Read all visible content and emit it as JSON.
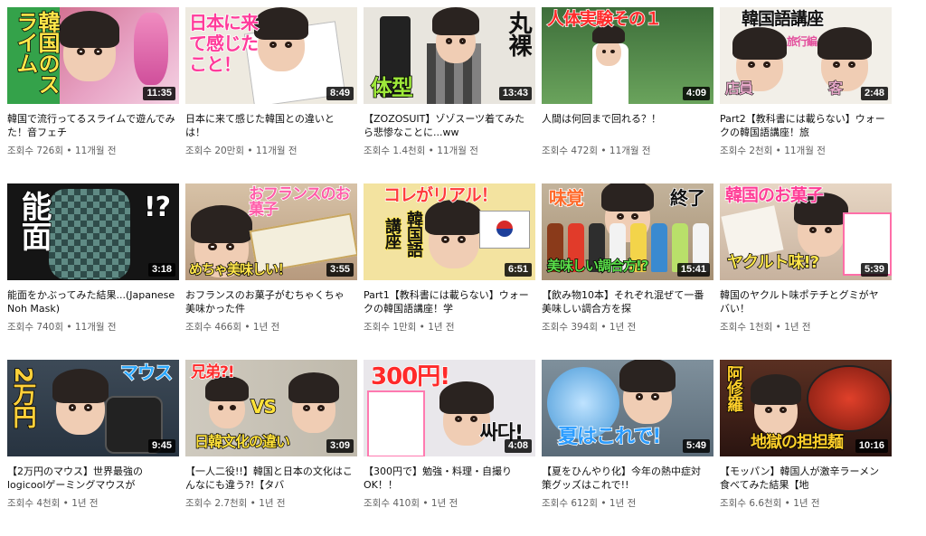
{
  "videos": [
    {
      "title": "韓国で流行ってるスライムで遊んでみた！音フェチ",
      "duration": "11:35",
      "views": "조회수 726회",
      "age": "11개월 전",
      "caption": "韓国のスライム",
      "bg": "#d46a8a",
      "accent": "#ffe74a"
    },
    {
      "title": "日本に来て感じた韓国との違いとは！",
      "duration": "8:49",
      "views": "조회수 20만회",
      "age": "11개월 전",
      "caption": "日本に来て感じたこと！",
      "bg": "#f4f0e6",
      "accent": "#ff4fa0"
    },
    {
      "title": "【ZOZOSUIT】ゾゾスーツ着てみたら悲惨なことに...ww",
      "duration": "13:43",
      "views": "조회수 1.4천회",
      "age": "11개월 전",
      "caption": "体型",
      "caption2": "丸裸",
      "bg": "#e9e6df",
      "accent": "#9ee83a"
    },
    {
      "title": "人間は何回まで回れる？！",
      "duration": "4:09",
      "views": "조회수 472회",
      "age": "11개월 전",
      "caption": "人体実験その１",
      "bg": "#3f7a3a",
      "accent": "#ff2a2a"
    },
    {
      "title": "Part2【教科書には載らない】ウォークの韓国語講座！旅",
      "duration": "2:48",
      "views": "조회수 2천회",
      "age": "11개월 전",
      "caption": "韓国語講座",
      "caption2": "旅行編",
      "caption3": "店員",
      "caption4": "客",
      "bg": "#f2f0ea",
      "accent": "#e7a8c9"
    },
    {
      "title": "能面をかぶってみた結果...(Japanese Noh Mask)",
      "duration": "3:18",
      "views": "조회수 740회",
      "age": "11개월 전",
      "caption": "能面",
      "caption2": "!?",
      "bg": "#1a1a1a",
      "accent": "#ffffff"
    },
    {
      "title": "おフランスのお菓子がむちゃくちゃ美味かった件",
      "duration": "3:55",
      "views": "조회수 466회",
      "age": "1년 전",
      "caption": "おフランスのお菓子",
      "caption2": "めちゃ美味しい！",
      "bg": "#c9b39a",
      "accent": "#ff8fc0"
    },
    {
      "title": "Part1【教科書には載らない】ウォークの韓国語講座！学",
      "duration": "6:51",
      "views": "조회수 1만회",
      "age": "1년 전",
      "caption": "コレがリアル！",
      "caption2": "韓国語",
      "caption3": "講座",
      "bg": "#f3e3a0",
      "accent": "#ff3b3b"
    },
    {
      "title": "【飲み物10本】それぞれ混ぜて一番美味しい調合方を探",
      "duration": "15:41",
      "views": "조회수 394회",
      "age": "1년 전",
      "caption": "味覚",
      "caption2": "終了",
      "caption3": "美味しい調合方!?",
      "bg": "#b7a58c",
      "accent": "#5be04a"
    },
    {
      "title": "韓国のヤクルト味ポテチとグミがヤバい！",
      "duration": "5:39",
      "views": "조회수 1천회",
      "age": "1년 전",
      "caption": "韓国のお菓子",
      "caption2": "ヤクルト味!?",
      "bg": "#d9c7b5",
      "accent": "#ff6ea8"
    },
    {
      "title": "【2万円のマウス】世界最強のlogicoolゲーミングマウスが",
      "duration": "9:45",
      "views": "조회수 4천회",
      "age": "1년 전",
      "caption": "2万円",
      "caption2": "マウス",
      "bg": "#3a4a5a",
      "accent": "#ffd13a"
    },
    {
      "title": "【一人二役!!】韓国と日本の文化はこんなにも違う?!【タバ",
      "duration": "3:09",
      "views": "조회수 2.7천회",
      "age": "1년 전",
      "caption": "兄弟?!",
      "caption2": "VS",
      "caption3": "日韓文化の違い",
      "bg": "#cfcabf",
      "accent": "#ffe23a"
    },
    {
      "title": "【300円で】勉強・料理・自撮りOK！！",
      "duration": "4:08",
      "views": "조회수 410회",
      "age": "1년 전",
      "caption": "300円!",
      "caption2": "싸다!",
      "bg": "#e8e6ea",
      "accent": "#ff2a2a"
    },
    {
      "title": "【夏をひんやり化】今年の熱中症対策グッズはこれで!!",
      "duration": "5:49",
      "views": "조회수 612회",
      "age": "1년 전",
      "caption": "夏はこれで!",
      "bg": "#6a7c8a",
      "accent": "#2a9cff"
    },
    {
      "title": "【モッパン】韓国人が激辛ラーメン食べてみた結果【地",
      "duration": "10:16",
      "views": "조회수 6.6천회",
      "age": "1년 전",
      "caption": "阿修羅",
      "caption2": "地獄の担担麺",
      "bg": "#4a2a22",
      "accent": "#ffcf2a"
    }
  ],
  "separator": " • "
}
